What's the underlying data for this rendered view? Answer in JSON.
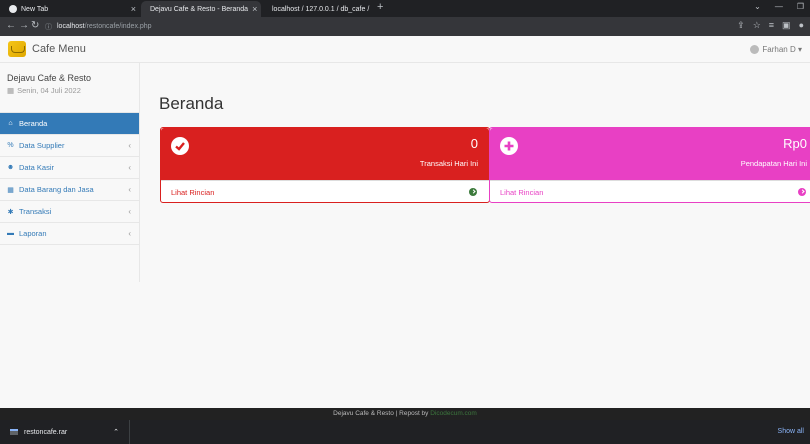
{
  "browser": {
    "tabs": [
      {
        "title": "New Tab"
      },
      {
        "title": "Dejavu Cafe & Resto - Beranda"
      },
      {
        "title": "localhost / 127.0.0.1 / db_cafe / "
      }
    ],
    "new_tab_label": "+",
    "url": {
      "host": "localhost",
      "path": "/restoncafe/index.php"
    }
  },
  "app": {
    "brand": "Cafe Menu",
    "user": "Farhan D ▾"
  },
  "sidebar": {
    "title": "Dejavu Cafe & Resto",
    "date": "Senin, 04 Juli 2022",
    "items": [
      {
        "label": "Beranda",
        "icon": "home-icon",
        "active": true
      },
      {
        "label": "Data Supplier",
        "icon": "percent-icon"
      },
      {
        "label": "Data Kasir",
        "icon": "users-icon"
      },
      {
        "label": "Data Barang dan Jasa",
        "icon": "grid-icon"
      },
      {
        "label": "Transaksi",
        "icon": "gear-icon"
      },
      {
        "label": "Laporan",
        "icon": "folder-icon"
      }
    ]
  },
  "main": {
    "title": "Beranda",
    "cards": [
      {
        "value": "0",
        "label": "Transaksi Hari Ini",
        "link": "Lihat Rincian",
        "color": "#d9201f"
      },
      {
        "value": "Rp0",
        "label": "Pendapatan Hari Ini",
        "link": "Lihat Rincian",
        "color": "#e840c4"
      }
    ]
  },
  "footer": {
    "text": "Dejavu Cafe & Resto | Repost by ",
    "link": "Dicodecum.com"
  },
  "downloads": {
    "file": "restoncafe.rar",
    "show_all": "Show all"
  }
}
